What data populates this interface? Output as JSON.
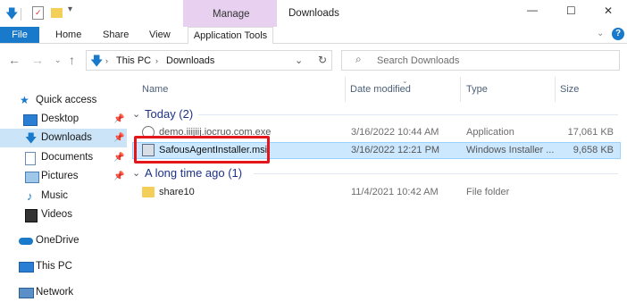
{
  "window": {
    "title": "Downloads",
    "contextual_group": "Manage",
    "controls": {
      "minimize": "—",
      "maximize": "☐",
      "close": "✕"
    }
  },
  "ribbon": {
    "tabs": [
      "File",
      "Home",
      "Share",
      "View",
      "Application Tools"
    ]
  },
  "address_bar": {
    "breadcrumb": [
      "This PC",
      "Downloads"
    ],
    "search_placeholder": "Search Downloads"
  },
  "sidebar": {
    "items": [
      {
        "label": "Quick access",
        "icon": "star-icon",
        "pinned": false
      },
      {
        "label": "Desktop",
        "icon": "desktop-icon",
        "pinned": true
      },
      {
        "label": "Downloads",
        "icon": "download-arrow-icon",
        "pinned": true,
        "selected": true
      },
      {
        "label": "Documents",
        "icon": "documents-icon",
        "pinned": true
      },
      {
        "label": "Pictures",
        "icon": "pictures-icon",
        "pinned": true
      },
      {
        "label": "Music",
        "icon": "music-icon",
        "pinned": false
      },
      {
        "label": "Videos",
        "icon": "videos-icon",
        "pinned": false
      },
      {
        "label": "OneDrive",
        "icon": "cloud-icon",
        "pinned": false
      },
      {
        "label": "This PC",
        "icon": "computer-icon",
        "pinned": false
      },
      {
        "label": "Network",
        "icon": "network-icon",
        "pinned": false
      }
    ]
  },
  "columns": [
    "Name",
    "Date modified",
    "Type",
    "Size"
  ],
  "groups": [
    {
      "label": "Today (2)",
      "files": [
        {
          "name": "demo.iiijiij.iocruo.com.exe",
          "date": "3/16/2022 10:44 AM",
          "type": "Application",
          "size": "17,061 KB"
        },
        {
          "name": "SafousAgentInstaller.msi",
          "date": "3/16/2022 12:21 PM",
          "type": "Windows Installer ...",
          "size": "9,658 KB",
          "selected": true
        }
      ]
    },
    {
      "label": "A long time ago (1)",
      "files": [
        {
          "name": "share10",
          "date": "11/4/2021 10:42 AM",
          "type": "File folder",
          "size": ""
        }
      ]
    }
  ]
}
